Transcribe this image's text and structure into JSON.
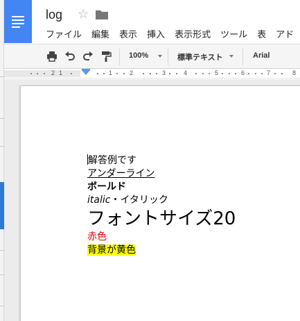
{
  "document": {
    "title": "log"
  },
  "menu": [
    "ファイル",
    "編集",
    "表示",
    "挿入",
    "表示形式",
    "ツール",
    "表",
    "アド"
  ],
  "toolbar": {
    "zoom": "100%",
    "style": "標準テキスト",
    "font": "Arial"
  },
  "ruler": {
    "numbers": [
      "2",
      "1",
      "1",
      "2",
      "3",
      "4",
      "5",
      "6",
      "7",
      "8"
    ]
  },
  "content": {
    "line1": "解答例です",
    "line2": "アンダーライン",
    "line3": "ボールド",
    "line4_italic": "italic",
    "line4_sep": "・",
    "line4_rest": "イタリック",
    "line5": "フォントサイズ20",
    "line6": "赤色",
    "line7": "背景が黄色"
  },
  "colors": {
    "brand": "#4285f4",
    "red_text": "#e00000",
    "highlight": "#ffff00"
  }
}
